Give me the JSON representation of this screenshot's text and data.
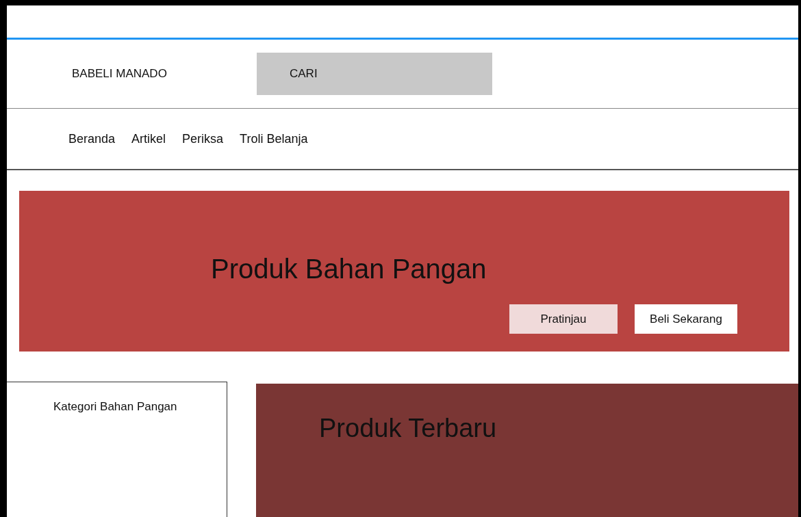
{
  "header": {
    "brand": "BABELI MANADO",
    "search": {
      "placeholder": "CARI"
    }
  },
  "nav": [
    {
      "label": "Beranda"
    },
    {
      "label": "Artikel"
    },
    {
      "label": "Periksa"
    },
    {
      "label": "Troli Belanja"
    }
  ],
  "banner": {
    "title": "Produk Bahan Pangan",
    "buttons": [
      {
        "label": "Pratinjau",
        "kind": "secondary"
      },
      {
        "label": "Beli Sekarang",
        "kind": "primary"
      }
    ]
  },
  "sidebar": {
    "title": "Kategori Bahan Pangan"
  },
  "featured": {
    "title": "Produk Terbaru"
  }
}
